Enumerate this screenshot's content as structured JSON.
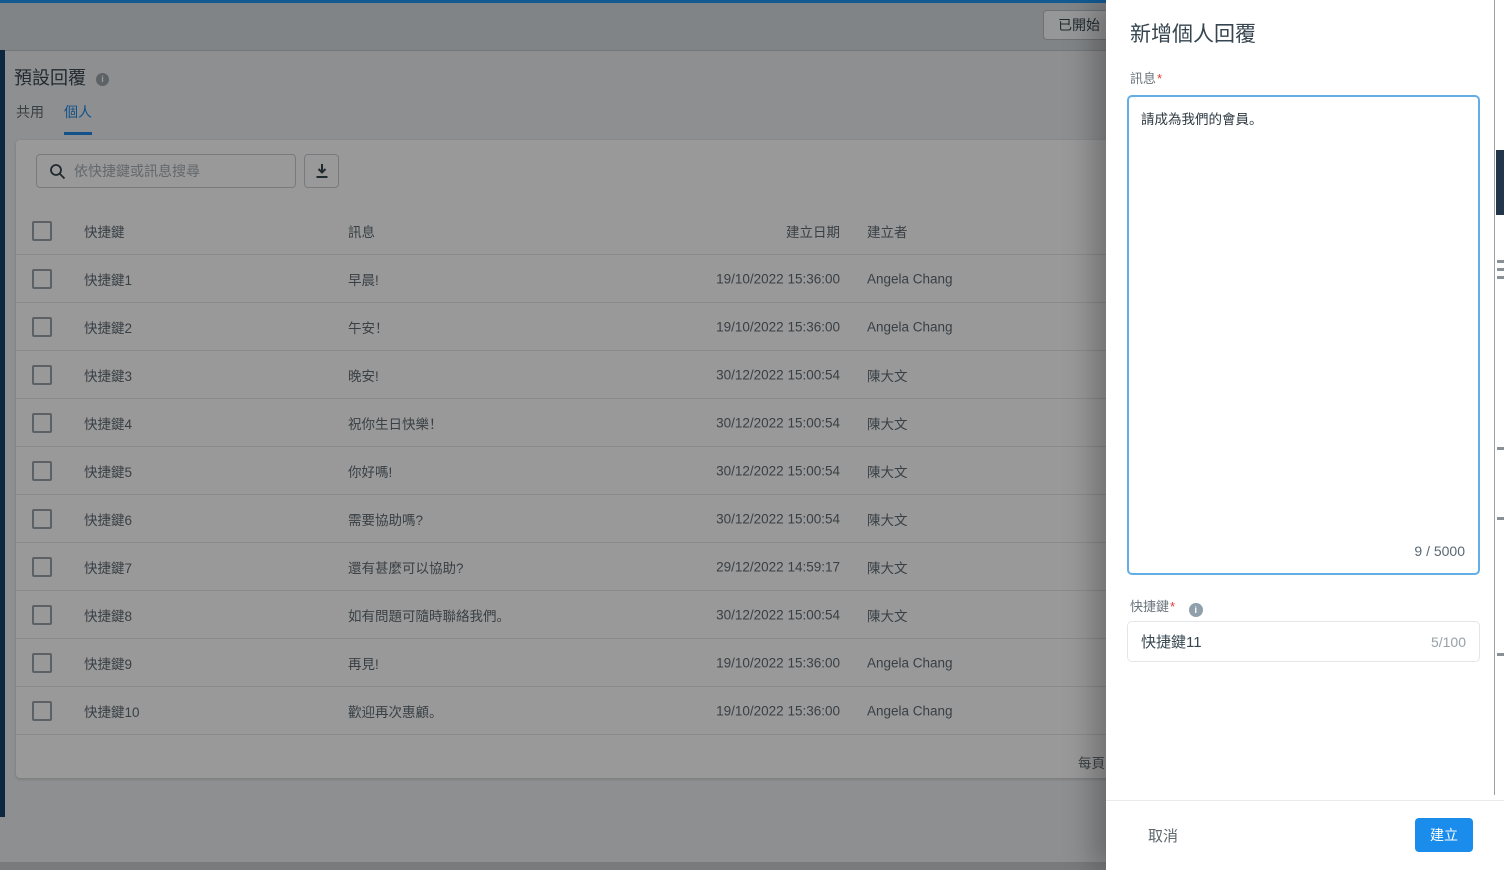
{
  "colors": {
    "accent": "#1e88e5",
    "create_button": "#1a8ceb",
    "rail_navy": "#17426b",
    "topbar_line": "#2196f3",
    "required_red": "#e53935"
  },
  "topbar": {
    "started_label": "已開始"
  },
  "page": {
    "title": "預設回覆",
    "tabs": [
      {
        "label": "共用"
      },
      {
        "label": "個人"
      }
    ],
    "search_placeholder": "依快捷鍵或訊息搜尋",
    "table": {
      "columns": [
        "快捷鍵",
        "訊息",
        "建立日期",
        "建立者"
      ],
      "rows": [
        {
          "shortcut": "快捷鍵1",
          "message": "早晨!",
          "created": "19/10/2022 15:36:00",
          "creator": "Angela Chang"
        },
        {
          "shortcut": "快捷鍵2",
          "message": "午安！",
          "created": "19/10/2022 15:36:00",
          "creator": "Angela Chang"
        },
        {
          "shortcut": "快捷鍵3",
          "message": "晚安!",
          "created": "30/12/2022 15:00:54",
          "creator": "陳大文"
        },
        {
          "shortcut": "快捷鍵4",
          "message": "祝你生日快樂！",
          "created": "30/12/2022 15:00:54",
          "creator": "陳大文"
        },
        {
          "shortcut": "快捷鍵5",
          "message": "你好嗎!",
          "created": "30/12/2022 15:00:54",
          "creator": "陳大文"
        },
        {
          "shortcut": "快捷鍵6",
          "message": "需要協助嗎?",
          "created": "30/12/2022 15:00:54",
          "creator": "陳大文"
        },
        {
          "shortcut": "快捷鍵7",
          "message": "還有甚麼可以協助?",
          "created": "29/12/2022 14:59:17",
          "creator": "陳大文"
        },
        {
          "shortcut": "快捷鍵8",
          "message": "如有問題可隨時聯絡我們。",
          "created": "30/12/2022 15:00:54",
          "creator": "陳大文"
        },
        {
          "shortcut": "快捷鍵9",
          "message": "再見!",
          "created": "19/10/2022 15:36:00",
          "creator": "Angela Chang"
        },
        {
          "shortcut": "快捷鍵10",
          "message": "歡迎再次惠顧。",
          "created": "19/10/2022 15:36:00",
          "creator": "Angela Chang"
        }
      ]
    },
    "pagination_label": "每頁"
  },
  "drawer": {
    "title": "新增個人回覆",
    "required_mark": "*",
    "message_label": "訊息",
    "message_value": "請成為我們的會員。",
    "message_counter": "9 / 5000",
    "shortcut_label": "快捷鍵",
    "shortcut_value": "快捷鍵11",
    "shortcut_counter": "5/100",
    "cancel_label": "取消",
    "create_label": "建立"
  }
}
